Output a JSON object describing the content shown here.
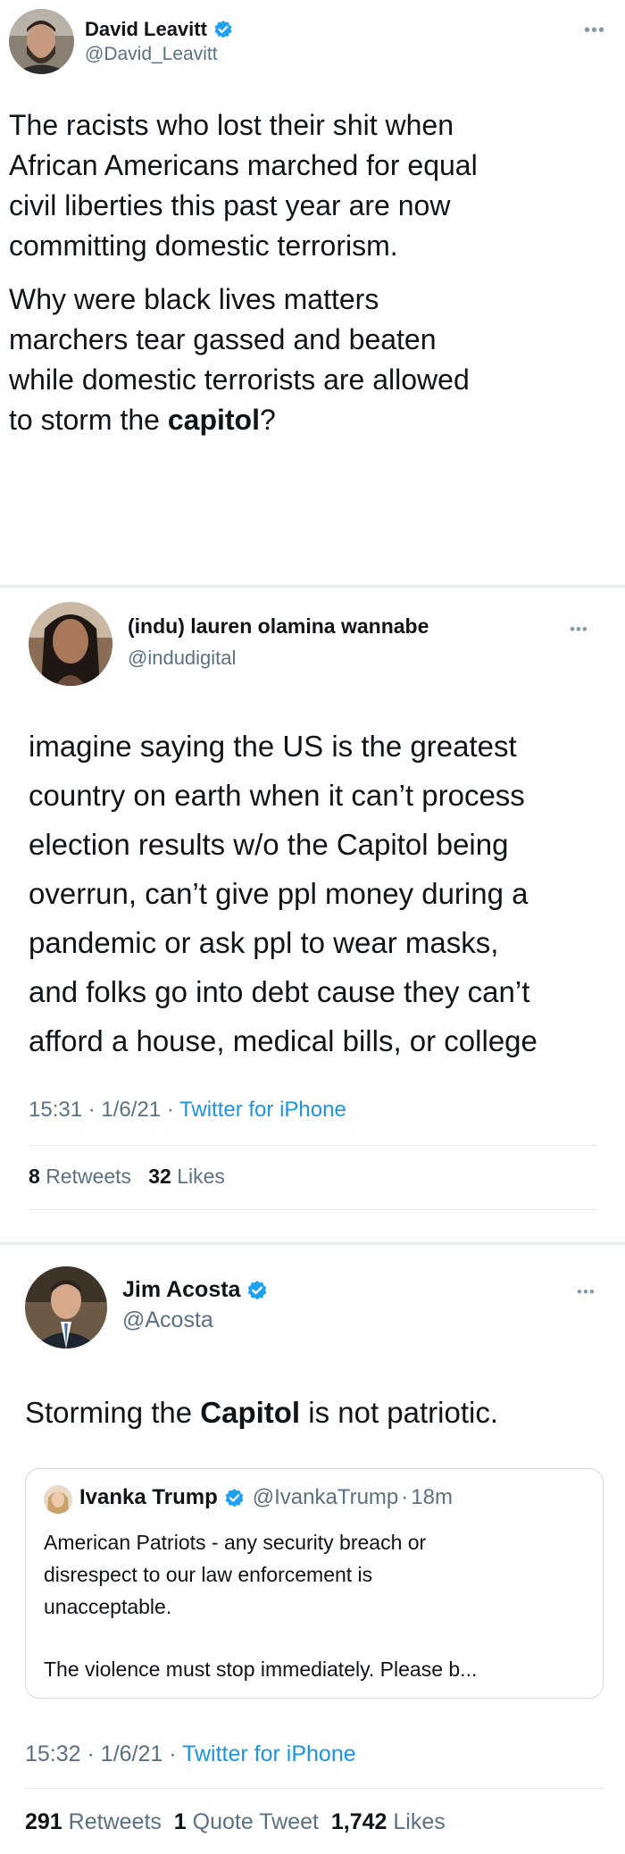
{
  "tweets": [
    {
      "author_name": "David Leavitt",
      "author_handle": "@David_Leavitt",
      "verified": true,
      "text_p1": [
        "The racists who lost their shit when",
        "African Americans marched for equal",
        "civil liberties this past year are now",
        "committing domestic terrorism."
      ],
      "text_p2": [
        "Why were black lives matters",
        "marchers tear gassed and beaten",
        "while domestic terrorists are allowed"
      ],
      "text_last_prefix": "to storm the ",
      "text_last_bold": "capitol",
      "text_last_suffix": "?",
      "more_icon": "ellipsis-icon"
    },
    {
      "author_name": "(indu) lauren olamina wannabe",
      "author_handle": "@indudigital",
      "verified": false,
      "text_lines": [
        "imagine saying the US is the greatest",
        "country on earth when it can’t process",
        "election results w/o the Capitol being",
        "overrun, can’t give ppl money during a",
        "pandemic or ask ppl to wear masks,",
        "and folks go into debt cause they can’t",
        "afford a house, medical bills, or college"
      ],
      "time": "15:31",
      "date": "1/6/21",
      "source": "Twitter for iPhone",
      "retweets_count": "8",
      "retweets_label": "Retweets",
      "likes_count": "32",
      "likes_label": "Likes",
      "more_icon": "ellipsis-icon"
    },
    {
      "author_name": "Jim Acosta",
      "author_handle": "@Acosta",
      "verified": true,
      "text_prefix": "Storming the ",
      "text_bold": "Capitol",
      "text_suffix": " is not patriotic.",
      "quoted": {
        "author_name": "Ivanka Trump",
        "author_handle": "@IvankaTrump",
        "time_ago": "18m",
        "verified": true,
        "lines": [
          "American Patriots - any security breach or",
          "disrespect to our law enforcement is",
          "unacceptable."
        ],
        "last_line": "The violence must stop immediately. Please b..."
      },
      "time": "15:32",
      "date": "1/6/21",
      "source": "Twitter for iPhone",
      "retweets_count": "291",
      "retweets_label": "Retweets",
      "quote_count": "1",
      "quote_label": "Quote Tweet",
      "likes_count": "1,742",
      "likes_label": "Likes",
      "more_icon": "ellipsis-icon"
    }
  ],
  "colors": {
    "accent_link": "#1b95e0",
    "verified_badge": "#1da1f2",
    "secondary_text": "#5b7083",
    "separator": "#e6ecf0"
  },
  "meta_separator": "·"
}
